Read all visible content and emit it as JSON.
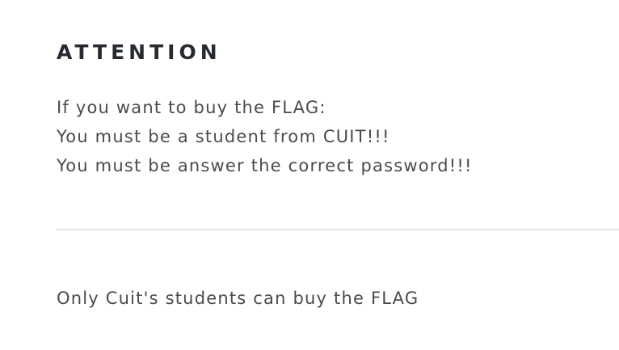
{
  "attention": {
    "heading": "ATTENTION",
    "lines": [
      "If you want to buy the FLAG:",
      "You must be a student from CUIT!!!",
      "You must be answer the correct password!!!"
    ]
  },
  "footer": {
    "notice": "Only Cuit's students can buy the FLAG"
  },
  "colors": {
    "heading": "#262b32",
    "body_text": "#4e4a4b",
    "divider": "#e4e4e4",
    "background": "#ffffff"
  }
}
